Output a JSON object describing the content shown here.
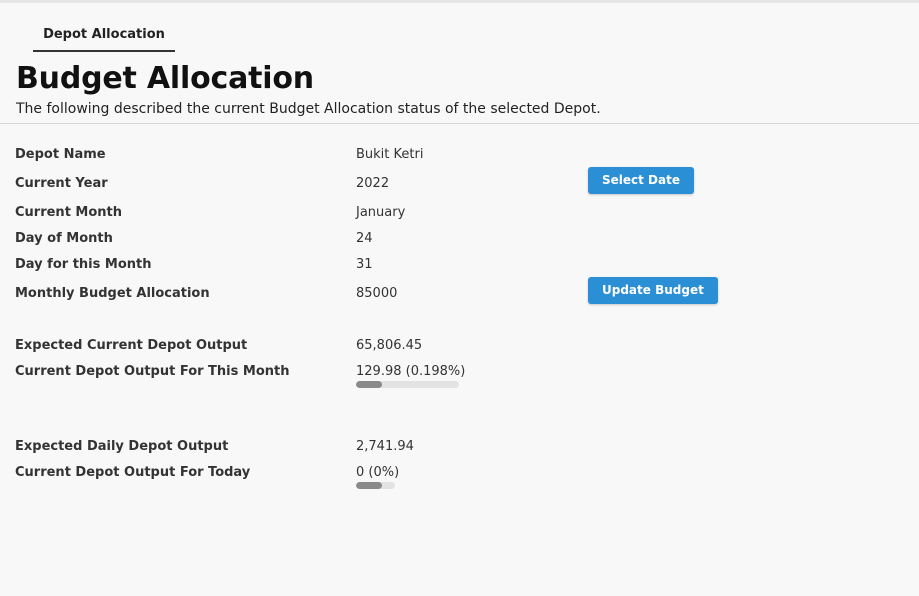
{
  "tabs": [
    {
      "label": "Depot Allocation",
      "active": true
    }
  ],
  "header": {
    "title": "Budget Allocation",
    "subtitle": "The following described the current Budget Allocation status of the selected Depot."
  },
  "rows": {
    "depot_name": {
      "label": "Depot Name",
      "value": "Bukit Ketri"
    },
    "current_year": {
      "label": "Current Year",
      "value": "2022"
    },
    "current_month": {
      "label": "Current Month",
      "value": "January"
    },
    "day_of_month": {
      "label": "Day of Month",
      "value": "24"
    },
    "days_in_month": {
      "label": "Day for this Month",
      "value": "31"
    },
    "monthly_budget": {
      "label": "Monthly Budget Allocation",
      "value": "85000"
    },
    "expected_current_output": {
      "label": "Expected Current Depot Output",
      "value": "65,806.45"
    },
    "current_output_month": {
      "label": "Current Depot Output For This Month",
      "value": "129.98 (0.198%)",
      "progress_percent": 0.198
    },
    "expected_daily_output": {
      "label": "Expected Daily Depot Output",
      "value": "2,741.94"
    },
    "current_output_today": {
      "label": "Current Depot Output For Today",
      "value": "0 (0%)",
      "progress_percent": 0
    }
  },
  "buttons": {
    "select_date": "Select Date",
    "update_budget": "Update Budget"
  },
  "colors": {
    "button_bg": "#2b8fd6",
    "progress_fill": "#8a8a8a",
    "progress_track": "#e3e3e3"
  }
}
